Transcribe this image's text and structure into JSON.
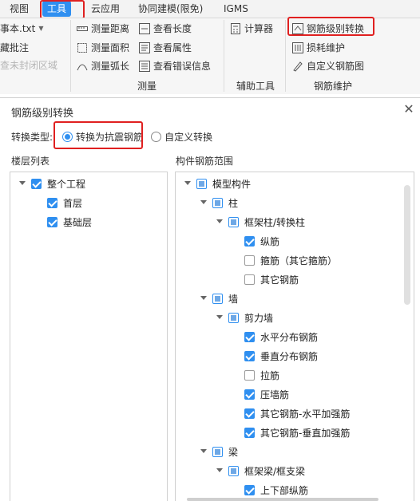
{
  "menu": {
    "tabs": [
      "视图",
      "工具",
      "云应用",
      "协同建模(限免)",
      "IGMS"
    ],
    "active_tab": "工具"
  },
  "ribbon": {
    "left": {
      "notepad": "事本.txt",
      "hide_comment": "藏批注",
      "unclosed_area": "查未封闭区域"
    },
    "measure": {
      "distance": "测量距离",
      "area": "测量面积",
      "arc": "测量弧长",
      "length": "查看长度",
      "property": "查看属性",
      "errors": "查看错误信息",
      "group_label": "测量"
    },
    "aux": {
      "calculator": "计算器",
      "group_label": "辅助工具"
    },
    "rebar": {
      "grade_convert": "钢筋级别转换",
      "loss": "损耗维护",
      "custom_diagram": "自定义钢筋图",
      "group_label": "钢筋维护"
    }
  },
  "dialog": {
    "title": "钢筋级别转换",
    "close_glyph": "✕",
    "convert_type_label": "转换类型:",
    "option_seismic": "转换为抗震钢筋",
    "option_custom": "自定义转换",
    "floor_list_label": "楼层列表",
    "component_range_label": "构件钢筋范围",
    "floors": {
      "root": "整个工程",
      "items": [
        "首层",
        "基础层"
      ]
    },
    "components": {
      "root": "模型构件",
      "column": "柱",
      "frame_column": "框架柱/转换柱",
      "col_long": "纵筋",
      "col_stirrup": "箍筋（其它箍筋）",
      "col_other": "其它钢筋",
      "wall": "墙",
      "shear_wall": "剪力墙",
      "w_horizontal": "水平分布钢筋",
      "w_vertical": "垂直分布钢筋",
      "w_tie": "拉筋",
      "w_press": "压墙筋",
      "w_other_h": "其它钢筋-水平加强筋",
      "w_other_v": "其它钢筋-垂直加强筋",
      "beam": "梁",
      "frame_beam": "框架梁/框支梁",
      "b_topbottom": "上下部纵筋"
    }
  },
  "colors": {
    "accent": "#2f8ff0",
    "highlight_box": "#e02020"
  }
}
